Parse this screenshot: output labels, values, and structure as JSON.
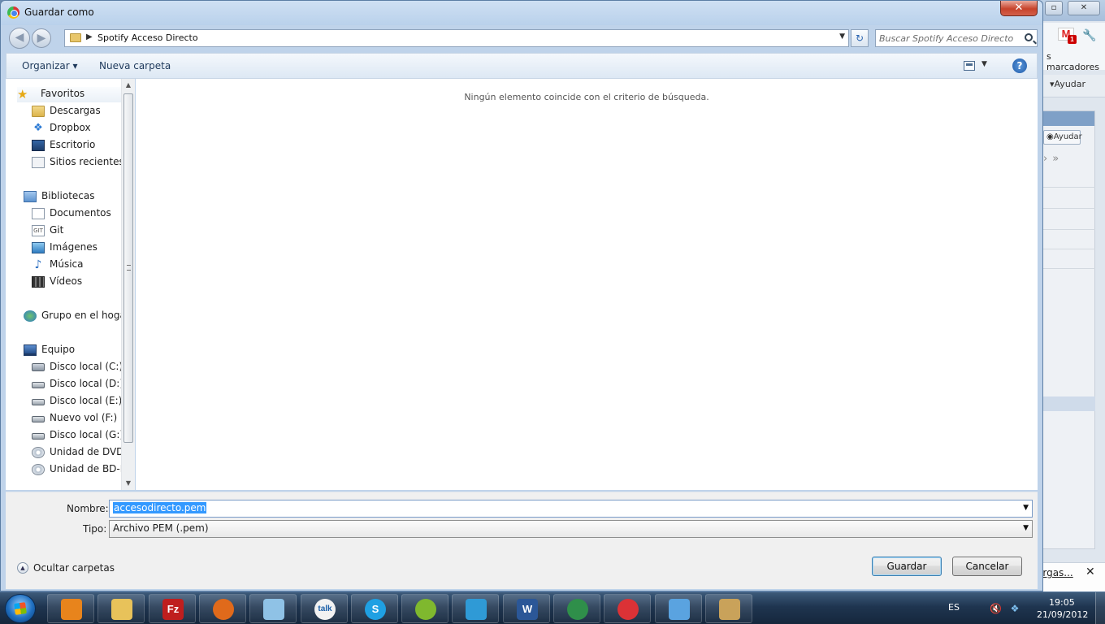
{
  "background_window": {
    "bookmarks_label_partial": "s marcadores",
    "help_menu": "Ayudar",
    "help_button": "Ayudar",
    "status_link_partial": "argas...",
    "close_glyph": "✕"
  },
  "dialog": {
    "title": "Guardar como",
    "close_glyph": "✕",
    "back_glyph": "◀",
    "forward_glyph": "▶",
    "breadcrumb_arrow": "▶",
    "breadcrumb": "Spotify Acceso Directo",
    "dropdown_glyph": "▼",
    "refresh_glyph": "↻",
    "search_placeholder": "Buscar Spotify Acceso Directo",
    "commands": {
      "organize": "Organizar ▾",
      "new_folder": "Nueva carpeta",
      "help_glyph": "?"
    },
    "nav": {
      "favorites": "Favoritos",
      "downloads": "Descargas",
      "dropbox": "Dropbox",
      "desktop": "Escritorio",
      "recent": "Sitios recientes",
      "libraries": "Bibliotecas",
      "documents": "Documentos",
      "git": "Git",
      "git_icon_text": "GIT",
      "images": "Imágenes",
      "music": "Música",
      "videos": "Vídeos",
      "homegroup": "Grupo en el hogar",
      "computer": "Equipo",
      "drive_c": "Disco local (C:)",
      "drive_d": "Disco local (D:)",
      "drive_e": "Disco local (E:)",
      "drive_f": "Nuevo vol (F:)",
      "drive_g": "Disco local (G:)",
      "dvd": "Unidad de DVD R",
      "bd": "Unidad de BD-RC"
    },
    "scroll_up_glyph": "▲",
    "scroll_down_glyph": "▼",
    "empty_message": "Ningún elemento coincide con el criterio de búsqueda.",
    "filename_label": "Nombre:",
    "filename_value": "accesodirecto.pem",
    "type_label": "Tipo:",
    "type_value": "Archivo PEM (.pem)",
    "hide_folders": "Ocultar carpetas",
    "hide_glyph": "▲",
    "save": "Guardar",
    "cancel": "Cancelar"
  },
  "taskbar": {
    "apps": [
      {
        "name": "media-player",
        "color": "#e8841c"
      },
      {
        "name": "file-explorer",
        "color": "#e8c25a"
      },
      {
        "name": "filezilla",
        "color": "#bf1e1e"
      },
      {
        "name": "firefox",
        "color": "#e06a1b"
      },
      {
        "name": "notepad",
        "color": "#8fc2e6"
      },
      {
        "name": "google-talk",
        "color": "#f2f2f2"
      },
      {
        "name": "skype",
        "color": "#1fa0e3"
      },
      {
        "name": "spotify",
        "color": "#7fb82e"
      },
      {
        "name": "twitter",
        "color": "#2f9ad6"
      },
      {
        "name": "word",
        "color": "#2b5797"
      },
      {
        "name": "globe",
        "color": "#2f8f4a"
      },
      {
        "name": "chrome",
        "color": "#db3236"
      },
      {
        "name": "messenger",
        "color": "#5aa3e0"
      },
      {
        "name": "paint",
        "color": "#c9a25a"
      }
    ],
    "filezilla_text": "Fz",
    "talk_text": "talk",
    "skype_text": "S",
    "word_text": "W",
    "language": "ES",
    "volume_glyph": "🔇",
    "dropbox_glyph": "❖",
    "time": "19:05",
    "date": "21/09/2012"
  }
}
